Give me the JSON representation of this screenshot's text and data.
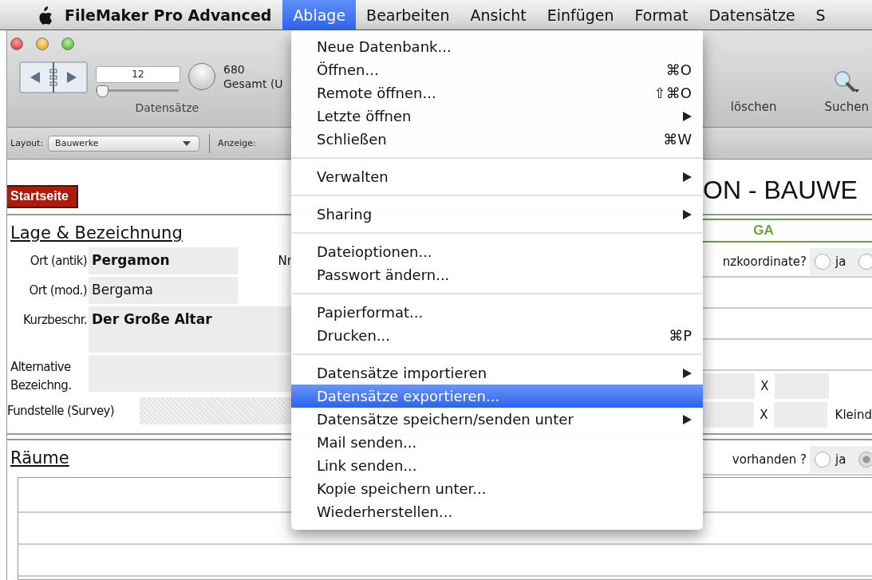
{
  "menubar": {
    "app": "FileMaker Pro Advanced",
    "menus": [
      {
        "label": "Ablage",
        "selected": true
      },
      {
        "label": "Bearbeiten",
        "selected": false
      },
      {
        "label": "Ansicht",
        "selected": false
      },
      {
        "label": "Einfügen",
        "selected": false
      },
      {
        "label": "Format",
        "selected": false
      },
      {
        "label": "Datensätze",
        "selected": false
      },
      {
        "label": "S",
        "selected": false
      }
    ]
  },
  "toolbar": {
    "record": "12",
    "slider": {
      "level": 0.02
    },
    "total": "680",
    "total_label": "Gesamt (U",
    "group_label": "Datensätze",
    "right": [
      {
        "kind": "label",
        "label": "löschen"
      },
      {
        "kind": "search",
        "label": "Suchen"
      }
    ]
  },
  "layout_bar": {
    "layout_label": "Layout:",
    "layout": "Bauwerke",
    "view_label": "Anzeige:"
  },
  "content": {
    "home_button": "Startseite",
    "title": "ON - BAUWE",
    "section1": {
      "heading": "Lage & Bezeichnung",
      "nr_label": "Nr",
      "fields": [
        {
          "label": "Ort (antik)",
          "value": "Pergamon",
          "bold": true,
          "kind": "short"
        },
        {
          "label": "Ort (mod.)",
          "value": "Bergama",
          "bold": false,
          "kind": "short"
        },
        {
          "label": "Kurzbeschr.",
          "value": "Der Große Altar",
          "bold": true,
          "kind": "tall"
        },
        {
          "label": "Alternative Bezeichng.",
          "kind": "tall2"
        },
        {
          "label": "Fundstelle (Survey)",
          "kind": "hatched"
        }
      ]
    },
    "ga": "GA",
    "coord": {
      "label": "nzkoordinate?",
      "options": [
        {
          "label": "ja",
          "selected": false
        },
        {
          "selected": false
        }
      ]
    },
    "dims": [
      {
        "x": "X"
      },
      {
        "x": "X",
        "note": "Kleind"
      }
    ],
    "section2": {
      "heading": "Räume"
    },
    "rooms": {
      "label": "vorhanden ?",
      "options": [
        {
          "label": "ja",
          "selected": false
        },
        {
          "selected": true
        }
      ]
    }
  },
  "menu": {
    "items": [
      {
        "kind": "item",
        "label": "Neue Datenbank...",
        "selected": false
      },
      {
        "kind": "item",
        "label": "Öffnen...",
        "shortcut": "⌘O",
        "selected": false
      },
      {
        "kind": "item",
        "label": "Remote öffnen...",
        "shortcut": "⇧⌘O",
        "selected": false
      },
      {
        "kind": "item",
        "label": "Letzte öffnen",
        "submenu": true,
        "selected": false
      },
      {
        "kind": "item",
        "label": "Schließen",
        "shortcut": "⌘W",
        "selected": false
      },
      {
        "kind": "separator"
      },
      {
        "kind": "item",
        "label": "Verwalten",
        "submenu": true,
        "selected": false
      },
      {
        "kind": "separator"
      },
      {
        "kind": "item",
        "label": "Sharing",
        "submenu": true,
        "selected": false
      },
      {
        "kind": "separator"
      },
      {
        "kind": "item",
        "label": "Dateioptionen...",
        "selected": false
      },
      {
        "kind": "item",
        "label": "Passwort ändern...",
        "selected": false
      },
      {
        "kind": "separator"
      },
      {
        "kind": "item",
        "label": "Papierformat...",
        "selected": false
      },
      {
        "kind": "item",
        "label": "Drucken...",
        "shortcut": "⌘P",
        "selected": false
      },
      {
        "kind": "separator"
      },
      {
        "kind": "item",
        "label": "Datensätze importieren",
        "submenu": true,
        "selected": false
      },
      {
        "kind": "item",
        "label": "Datensätze exportieren...",
        "selected": true
      },
      {
        "kind": "item",
        "label": "Datensätze speichern/senden unter",
        "submenu": true,
        "selected": false
      },
      {
        "kind": "item",
        "label": "Mail senden...",
        "selected": false
      },
      {
        "kind": "item",
        "label": "Link senden...",
        "selected": false
      },
      {
        "kind": "item",
        "label": "Kopie speichern unter...",
        "selected": false
      },
      {
        "kind": "item",
        "label": "Wiederherstellen...",
        "selected": false
      }
    ]
  }
}
